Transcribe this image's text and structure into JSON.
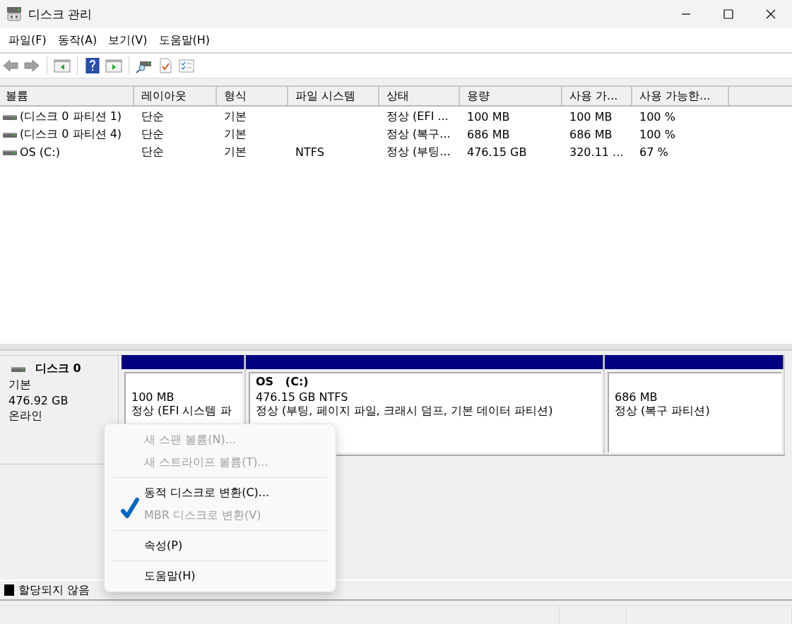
{
  "window": {
    "title": "디스크 관리"
  },
  "menu_bar": [
    "파일(F)",
    "동작(A)",
    "보기(V)",
    "도움말(H)"
  ],
  "volume_list": {
    "columns": [
      "볼륨",
      "레이아웃",
      "형식",
      "파일 시스템",
      "상태",
      "용량",
      "사용 가...",
      "사용 가능한..."
    ],
    "rows": [
      {
        "cells": [
          "(디스크 0 파티션 1)",
          "단순",
          "기본",
          "",
          "정상 (EFI ...",
          "100 MB",
          "100 MB",
          "100 %"
        ]
      },
      {
        "cells": [
          "(디스크 0 파티션 4)",
          "단순",
          "기본",
          "",
          "정상 (복구...",
          "686 MB",
          "686 MB",
          "100 %"
        ]
      },
      {
        "cells": [
          "OS (C:)",
          "단순",
          "기본",
          "NTFS",
          "정상 (부팅...",
          "476.15 GB",
          "320.11 ...",
          "67 %"
        ]
      }
    ]
  },
  "disk_view": {
    "disk": {
      "name": "디스크 0",
      "type": "기본",
      "size": "476.92 GB",
      "status": "온라인"
    },
    "partitions": [
      {
        "size": "100 MB",
        "status": "정상 (EFI 시스템 파"
      },
      {
        "name": "OS   (C:)",
        "size": "476.15 GB NTFS",
        "status": "정상 (부팅, 페이지 파일, 크래시 덤프, 기본 데이터 파티션)"
      },
      {
        "size": "686 MB",
        "status": "정상 (복구 파티션)"
      }
    ]
  },
  "legend": [
    {
      "label": "할당되지 않음",
      "color": "#000000"
    }
  ],
  "context_menu": {
    "groups": [
      [
        {
          "label": "새 스팬 볼륨(N)...",
          "disabled": true,
          "checked": false
        },
        {
          "label": "새 스트라이프 볼륨(T)...",
          "disabled": true,
          "checked": false
        }
      ],
      [
        {
          "label": "동적 디스크로 변환(C)...",
          "disabled": false,
          "checked": false
        },
        {
          "label": "MBR 디스크로 변환(V)",
          "disabled": true,
          "checked": true
        }
      ],
      [
        {
          "label": "속성(P)",
          "disabled": false,
          "checked": false
        }
      ],
      [
        {
          "label": "도움말(H)",
          "disabled": false,
          "checked": false
        }
      ]
    ]
  }
}
